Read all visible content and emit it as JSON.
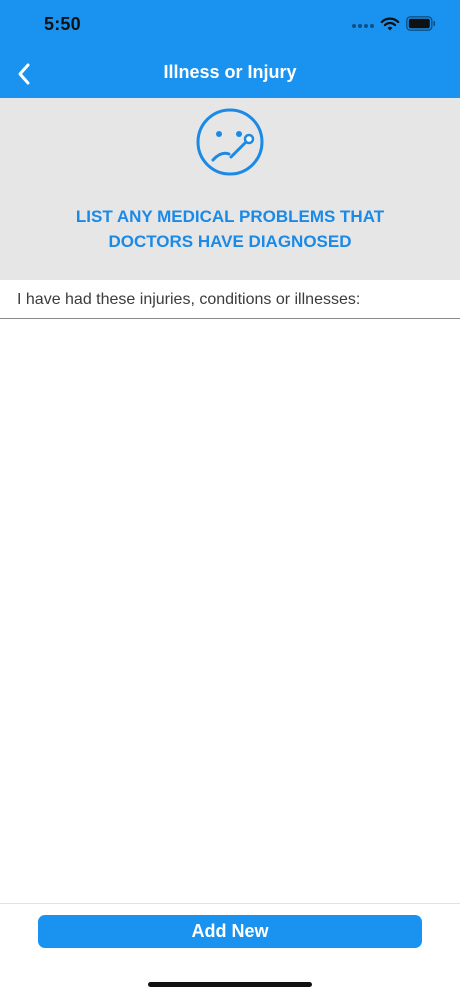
{
  "status_bar": {
    "time": "5:50",
    "icons": [
      "signal-dots-icon",
      "wifi-icon",
      "battery-icon"
    ]
  },
  "nav": {
    "title": "Illness or Injury",
    "back_icon": "chevron-left-icon"
  },
  "header": {
    "icon": "sick-face-thermometer-icon",
    "line1": "LIST ANY MEDICAL PROBLEMS THAT",
    "line2": "DOCTORS HAVE DIAGNOSED"
  },
  "section": {
    "label": "I have had these injuries, conditions or illnesses:"
  },
  "list": {
    "items": []
  },
  "footer": {
    "add_label": "Add New"
  },
  "colors": {
    "primary": "#1a93f0",
    "header_bg": "#e6e6e6",
    "header_text": "#1a8ae6"
  }
}
